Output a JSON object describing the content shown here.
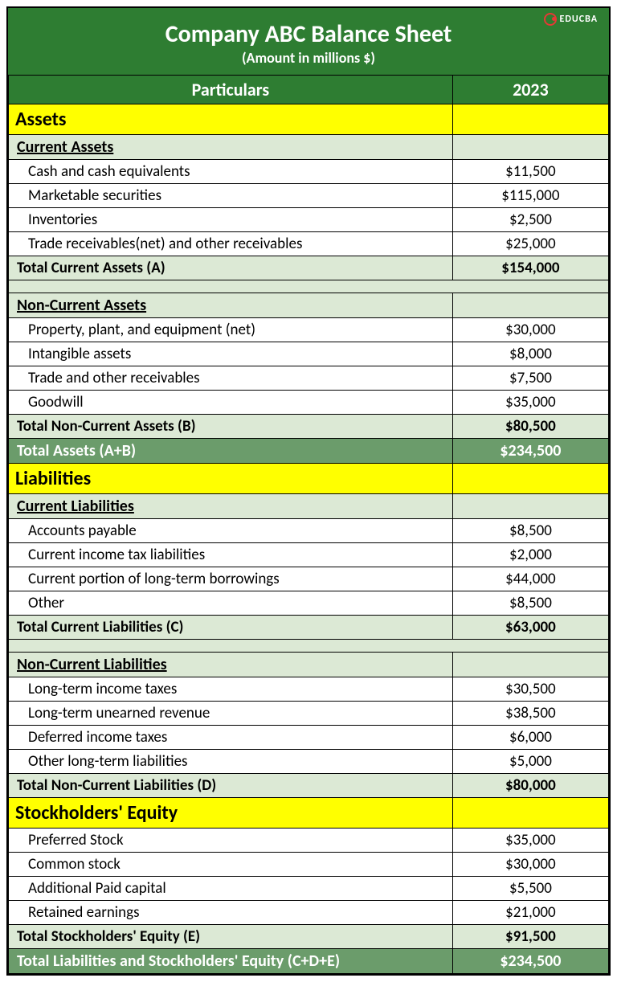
{
  "brand": "EDUCBA",
  "title": "Company ABC Balance Sheet",
  "subtitle": "(Amount in millions $)",
  "columns": {
    "label": "Particulars",
    "value": "2023"
  },
  "rows": [
    {
      "type": "section",
      "label": "Assets"
    },
    {
      "type": "subsection",
      "label": "Current Assets"
    },
    {
      "type": "item",
      "label": "Cash and cash equivalents",
      "value": "$11,500"
    },
    {
      "type": "item",
      "label": "Marketable securities",
      "value": "$115,000"
    },
    {
      "type": "item",
      "label": "Inventories",
      "value": "$2,500"
    },
    {
      "type": "item",
      "label": "Trade receivables(net) and other receivables",
      "value": "$25,000"
    },
    {
      "type": "subtotal",
      "label": "Total Current Assets (A)",
      "value": "$154,000"
    },
    {
      "type": "spacer"
    },
    {
      "type": "subsection",
      "label": "Non-Current Assets"
    },
    {
      "type": "item",
      "label": "Property, plant, and equipment (net)",
      "value": "$30,000"
    },
    {
      "type": "item",
      "label": "Intangible assets",
      "value": "$8,000"
    },
    {
      "type": "item",
      "label": "Trade and other receivables",
      "value": "$7,500"
    },
    {
      "type": "item",
      "label": "Goodwill",
      "value": "$35,000"
    },
    {
      "type": "subtotal",
      "label": "Total Non-Current Assets (B)",
      "value": "$80,500"
    },
    {
      "type": "total-green",
      "label": "Total Assets (A+B)",
      "value": "$234,500"
    },
    {
      "type": "section",
      "label": "Liabilities"
    },
    {
      "type": "subsection",
      "label": "Current Liabilities"
    },
    {
      "type": "item",
      "label": "Accounts payable",
      "value": "$8,500"
    },
    {
      "type": "item",
      "label": "Current income tax liabilities",
      "value": "$2,000"
    },
    {
      "type": "item",
      "label": "Current portion of long-term borrowings",
      "value": "$44,000"
    },
    {
      "type": "item",
      "label": "Other",
      "value": "$8,500"
    },
    {
      "type": "subtotal",
      "label": "Total Current Liabilities (C)",
      "value": "$63,000"
    },
    {
      "type": "spacer"
    },
    {
      "type": "subsection",
      "label": "Non-Current Liabilities"
    },
    {
      "type": "item",
      "label": "Long-term income taxes",
      "value": "$30,500"
    },
    {
      "type": "item",
      "label": "Long-term unearned revenue",
      "value": "$38,500"
    },
    {
      "type": "item",
      "label": "Deferred income taxes",
      "value": "$6,000"
    },
    {
      "type": "item",
      "label": "Other long-term liabilities",
      "value": "$5,000"
    },
    {
      "type": "subtotal",
      "label": "Total Non-Current Liabilities (D)",
      "value": "$80,000"
    },
    {
      "type": "section",
      "label": "Stockholders' Equity"
    },
    {
      "type": "item",
      "label": "Preferred Stock",
      "value": "$35,000"
    },
    {
      "type": "item",
      "label": "Common stock",
      "value": "$30,000"
    },
    {
      "type": "item",
      "label": "Additional Paid capital",
      "value": "$5,500"
    },
    {
      "type": "item",
      "label": "Retained earnings",
      "value": "$21,000"
    },
    {
      "type": "subtotal",
      "label": "Total Stockholders' Equity (E)",
      "value": "$91,500"
    },
    {
      "type": "total-green",
      "label": "Total Liabilities and Stockholders' Equity (C+D+E)",
      "value": "$234,500"
    }
  ]
}
